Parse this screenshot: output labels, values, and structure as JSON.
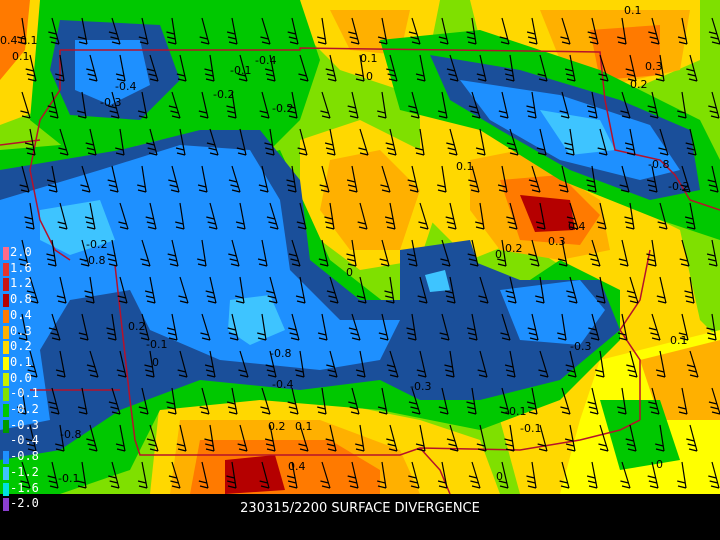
{
  "title": "230315/2200 SURFACE DIVERGENCE",
  "legend": [
    {
      "label": "2.0",
      "color": "#ff6b8b"
    },
    {
      "label": "1.6",
      "color": "#e8342c"
    },
    {
      "label": "1.2",
      "color": "#c81414"
    },
    {
      "label": "0.8",
      "color": "#b50000"
    },
    {
      "label": "0.4",
      "color": "#ff7a00"
    },
    {
      "label": "0.3",
      "color": "#ffb000"
    },
    {
      "label": "0.2",
      "color": "#ffd800"
    },
    {
      "label": "0.1",
      "color": "#ffff00"
    },
    {
      "label": "0.0",
      "color": "#c8f000"
    },
    {
      "label": "-0.1",
      "color": "#7fe000"
    },
    {
      "label": "-0.2",
      "color": "#00c800"
    },
    {
      "label": "-0.3",
      "color": "#009a00"
    },
    {
      "label": "-0.4",
      "color": "#1a4f9a"
    },
    {
      "label": "-0.8",
      "color": "#1e90ff"
    },
    {
      "label": "-1.2",
      "color": "#3ec4ff"
    },
    {
      "label": "-1.6",
      "color": "#00e0e0"
    },
    {
      "label": "-2.0",
      "color": "#8b3fd0"
    }
  ],
  "contour_labels": [
    {
      "text": "-0.4"
    },
    {
      "text": "-0.3"
    },
    {
      "text": "-0.2"
    },
    {
      "text": "-0.1"
    },
    {
      "text": "-0.4"
    },
    {
      "text": "-0.2"
    },
    {
      "text": "0.1"
    },
    {
      "text": "0"
    },
    {
      "text": "0.1"
    },
    {
      "text": "0.3"
    },
    {
      "text": "0.2"
    },
    {
      "text": "-0.8"
    },
    {
      "text": "0.4"
    },
    {
      "text": "0.3"
    },
    {
      "text": "0.2"
    },
    {
      "text": "0"
    },
    {
      "text": "-0.2"
    },
    {
      "text": "-0.8"
    },
    {
      "text": "0"
    },
    {
      "text": "-0.1"
    },
    {
      "text": "0.2"
    },
    {
      "text": "-0.8"
    },
    {
      "text": "-0.4"
    },
    {
      "text": "-0.3"
    },
    {
      "text": "-0.3"
    },
    {
      "text": "-0.1"
    },
    {
      "text": "-0.8"
    },
    {
      "text": "-0.1"
    },
    {
      "text": "0.2"
    },
    {
      "text": "0.1"
    },
    {
      "text": "0.4"
    },
    {
      "text": "-0.1"
    },
    {
      "text": "0"
    },
    {
      "text": "0"
    },
    {
      "text": "0.1"
    },
    {
      "text": "0.4"
    },
    {
      "text": "0.1"
    },
    {
      "text": "0.1"
    },
    {
      "text": "0.1"
    },
    {
      "text": "0"
    },
    {
      "text": "-0.2"
    }
  ]
}
